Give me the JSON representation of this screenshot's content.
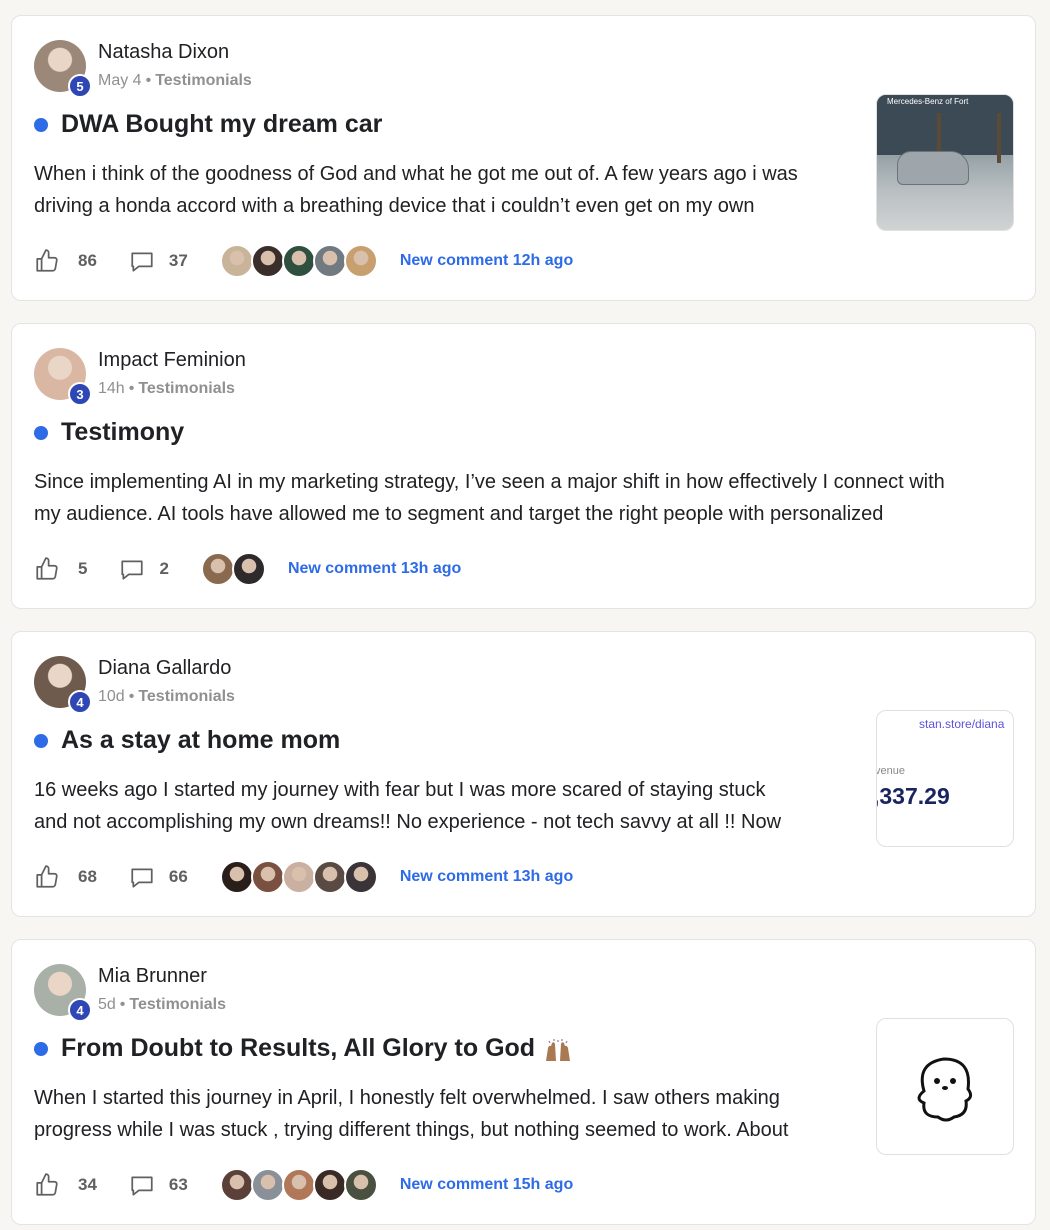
{
  "posts": [
    {
      "author": "Natasha Dixon",
      "level": "5",
      "time": "May 4",
      "category": "Testimonials",
      "title": "DWA Bought my dream car",
      "excerpt_line1": "When i think of the goodness of God and what he got me out of. A few years ago i was",
      "excerpt_line2": "driving a honda accord with a breathing device that i couldn’t even get on my own",
      "likes": "86",
      "comments": "37",
      "new_comment": "New comment 12h ago",
      "thumbnail": {
        "kind": "car-photo",
        "sign_text": "Mercedes-Benz of Fort"
      },
      "avatar_color": "#9b8878",
      "commenter_colors": [
        "#c9b49a",
        "#3a2e2a",
        "#2f4f3f",
        "#707a80",
        "#c8a070"
      ]
    },
    {
      "author": "Impact Feminion",
      "level": "3",
      "time": "14h",
      "category": "Testimonials",
      "title": "Testimony",
      "excerpt_line1": "Since implementing AI in my marketing strategy, I’ve seen a major shift in how effectively I connect with",
      "excerpt_line2": "my audience. AI tools have allowed me to segment and target the right people with personalized",
      "likes": "5",
      "comments": "2",
      "new_comment": "New comment 13h ago",
      "thumbnail": null,
      "avatar_color": "#d9b7a3",
      "commenter_colors": [
        "#8a6a4e",
        "#2e2a2c"
      ]
    },
    {
      "author": "Diana Gallardo",
      "level": "4",
      "time": "10d",
      "category": "Testimonials",
      "title": "As a stay at home mom",
      "excerpt_line1": "16 weeks ago I started my journey with fear but I was more scared of staying stuck",
      "excerpt_line2": "and not accomplishing my own dreams!! No experience - not tech savvy at all !! Now",
      "likes": "68",
      "comments": "66",
      "new_comment": "New comment 13h ago",
      "thumbnail": {
        "kind": "revenue-card",
        "url": "stan.store/diana",
        "label": "venue",
        "amount": ",337.29"
      },
      "avatar_color": "#6f5a4e",
      "commenter_colors": [
        "#2a1e1a",
        "#7a5040",
        "#c9b0a0",
        "#5a4a44",
        "#3a3438"
      ]
    },
    {
      "author": "Mia Brunner",
      "level": "4",
      "time": "5d",
      "category": "Testimonials",
      "title": "From Doubt to Results, All Glory to God",
      "excerpt_line1": "When I started this journey in April, I honestly felt overwhelmed. I saw others making",
      "excerpt_line2": "progress while I was stuck , trying different things, but nothing seemed to work. About",
      "likes": "34",
      "comments": "63",
      "new_comment": "New comment 15h ago",
      "thumbnail": {
        "kind": "ghost-sticker"
      },
      "avatar_color": "#a8b0a8",
      "commenter_colors": [
        "#5a4038",
        "#8a9098",
        "#b07858",
        "#3a2a26",
        "#4a5040"
      ]
    }
  ],
  "colors": {
    "accent": "#2e6be6",
    "level_badge": "#2f47b5",
    "unread_dot": "#2e6be6"
  },
  "icons": {
    "like": "thumbs-up-icon",
    "comment": "speech-bubble-icon"
  }
}
